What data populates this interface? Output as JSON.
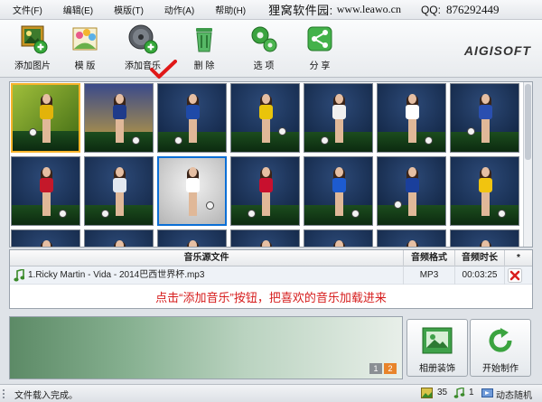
{
  "menu": {
    "items": [
      "文件(F)",
      "编辑(E)",
      "模版(T)",
      "动作(A)",
      "帮助(H)"
    ],
    "brand_text": "狸窝软件园:",
    "brand_url": "www.leawo.cn",
    "qq_label": "QQ:",
    "qq_number": "876292449"
  },
  "toolbar": {
    "add_photo_label": "添加图片",
    "template_label": "模 版",
    "add_music_label": "添加音乐",
    "delete_label": "删 除",
    "options_label": "选 项",
    "share_label": "分 享",
    "logo_text": "AIGISOFT"
  },
  "thumbnails": [
    {
      "kind": "poster",
      "shirt": "#e2b30a",
      "sky": "#6a8a2a"
    },
    {
      "kind": "poster2",
      "shirt": "#1f3b8a",
      "sky": "#3b4a7a"
    },
    {
      "kind": "player",
      "shirt": "#1f4aa8",
      "sky": "#0c1e3c"
    },
    {
      "kind": "player",
      "shirt": "#e9c40a",
      "sky": "#0d213f"
    },
    {
      "kind": "player",
      "shirt": "#f0f0f0",
      "sky": "#0d1f3a"
    },
    {
      "kind": "player",
      "shirt": "#ffffff",
      "sky": "#0c1e3a"
    },
    {
      "kind": "player",
      "shirt": "#2a4fb0",
      "sky": "#0b1c36"
    },
    {
      "kind": "player",
      "shirt": "#c4182a",
      "sky": "#0d203d"
    },
    {
      "kind": "player",
      "shirt": "#e2e8f0",
      "sky": "#10223f"
    },
    {
      "kind": "studio",
      "shirt": "#ffffff",
      "sky": "#d6d6d6"
    },
    {
      "kind": "player",
      "shirt": "#c8102e",
      "sky": "#0c1d38"
    },
    {
      "kind": "player",
      "shirt": "#1d5bd0",
      "sky": "#0c1e3a"
    },
    {
      "kind": "player",
      "shirt": "#1a3f9c",
      "sky": "#0b1c36"
    },
    {
      "kind": "player",
      "shirt": "#f1c40f",
      "sky": "#0d213f"
    },
    {
      "kind": "player",
      "shirt": "#dfe4ea",
      "sky": "#0d1f3a"
    },
    {
      "kind": "player",
      "shirt": "#c0c8d4",
      "sky": "#0d1f3a"
    },
    {
      "kind": "player",
      "shirt": "#e03a3a",
      "sky": "#0c1e3a"
    },
    {
      "kind": "player",
      "shirt": "#2a4fb0",
      "sky": "#0b1c36"
    },
    {
      "kind": "player",
      "shirt": "#ffffff",
      "sky": "#0d203d"
    },
    {
      "kind": "player",
      "shirt": "#e8384f",
      "sky": "#0d1f3a"
    },
    {
      "kind": "player",
      "shirt": "#2c56c0",
      "sky": "#0c1e3a"
    }
  ],
  "music_table": {
    "col_file": "音乐源文件",
    "col_format": "音频格式",
    "col_duration": "音频时长",
    "col_star": "*",
    "rows": [
      {
        "file": "1.Ricky Martin - Vida - 2014巴西世界杯.mp3",
        "format": "MP3",
        "duration": "00:03:25"
      }
    ],
    "hint": "点击“添加音乐”按钮，把喜欢的音乐加载进来"
  },
  "pager": [
    "1",
    "2"
  ],
  "buttons": {
    "album_decor_label": "相册装饰",
    "start_label": "开始制作"
  },
  "status": {
    "message": "文件载入完成。",
    "photo_count": "35",
    "music_count": "1",
    "mode": "动态随机"
  },
  "colors": {
    "accent_orange": "#e8842a",
    "hint_red": "#d61c1c",
    "selection_yellow": "#f7b32b",
    "highlight_blue": "#0b6fd6"
  }
}
